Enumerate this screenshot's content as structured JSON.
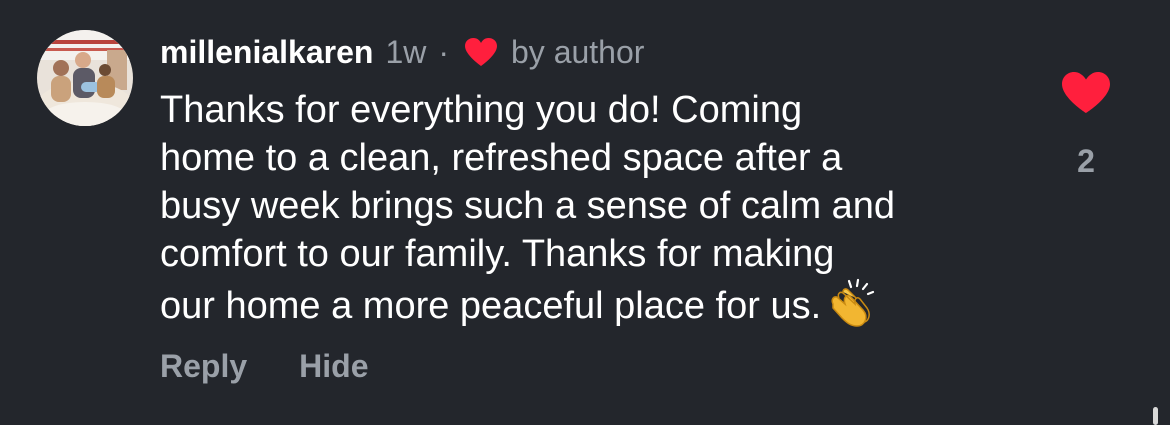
{
  "comment": {
    "username": "millenialkaren",
    "timestamp": "1w",
    "separator": "·",
    "author_like_label": "by author",
    "body_lines": [
      "Thanks for everything you do! Coming",
      "home to a clean, refreshed space after a",
      "busy week brings such a sense of calm and",
      "comfort to our family. Thanks for making",
      "our home a more peaceful place for us."
    ],
    "emoji": "clapping-hands-icon",
    "actions": {
      "reply": "Reply",
      "hide": "Hide"
    },
    "likes": {
      "count": "2",
      "liked": true
    }
  },
  "colors": {
    "background": "#23262c",
    "text_primary": "#ffffff",
    "text_secondary": "#9aa0a8",
    "heart": "#ff1f3d"
  }
}
